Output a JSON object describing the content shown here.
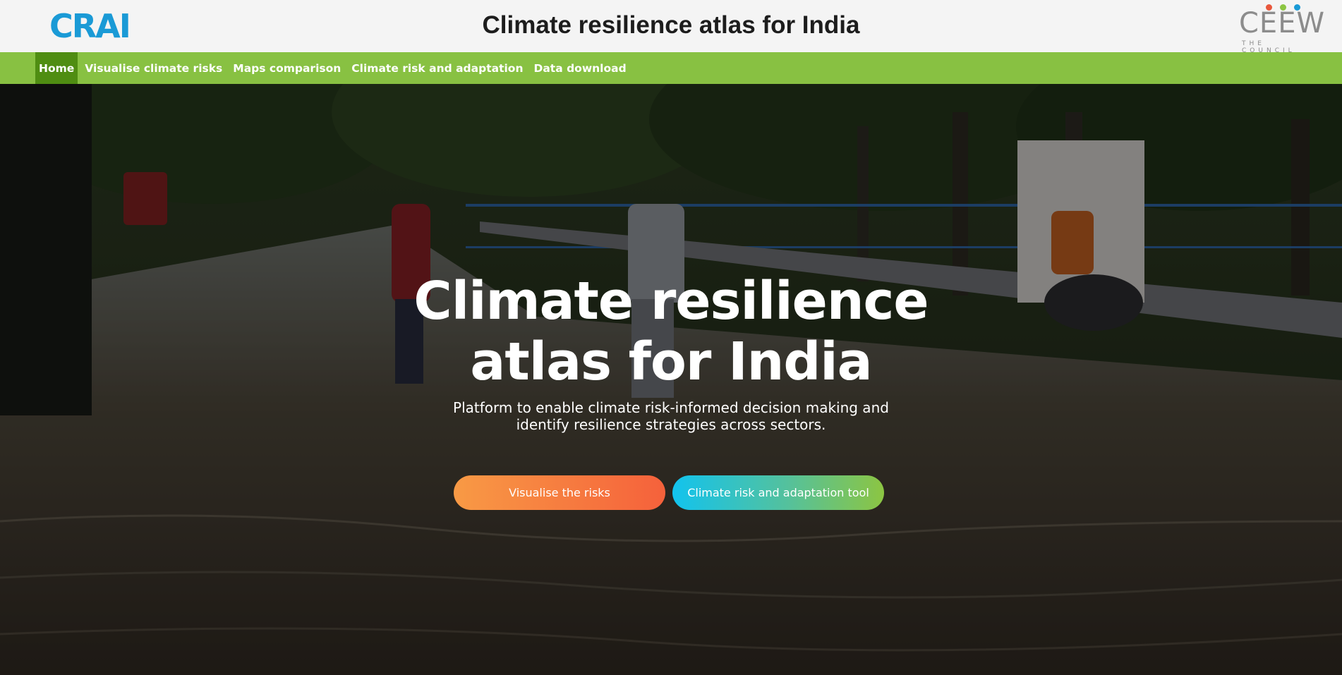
{
  "header": {
    "logo_text": "CRAI",
    "site_title": "Climate resilience atlas for India",
    "partner_logo": {
      "word": "CEEW",
      "subtext": "THE COUNCIL",
      "dot_colors": [
        "#e8573c",
        "#8cc542",
        "#1a9ad6"
      ]
    }
  },
  "nav": {
    "items": [
      {
        "label": "Home",
        "active": true
      },
      {
        "label": "Visualise climate risks",
        "active": false
      },
      {
        "label": "Maps comparison",
        "active": false
      },
      {
        "label": "Climate risk and adaptation",
        "active": false
      },
      {
        "label": "Data download",
        "active": false
      }
    ]
  },
  "hero": {
    "title_line1": "Climate resilience",
    "title_line2": "atlas for India",
    "subtitle_line1": "Platform to enable climate risk-informed decision making and",
    "subtitle_line2": "identify resilience strategies across sectors.",
    "buttons": {
      "primary_label": "Visualise the risks",
      "secondary_label": "Climate risk and adaptation tool"
    },
    "background_image": "flooded-street-photo"
  },
  "colors": {
    "brand_blue": "#1a9ad6",
    "nav_green": "#88c142",
    "nav_active": "#4f8d12",
    "cta_orange_start": "#f89a45",
    "cta_orange_end": "#f5613b",
    "cta_tool_start": "#12c3ee",
    "cta_tool_end": "#8cc542"
  }
}
